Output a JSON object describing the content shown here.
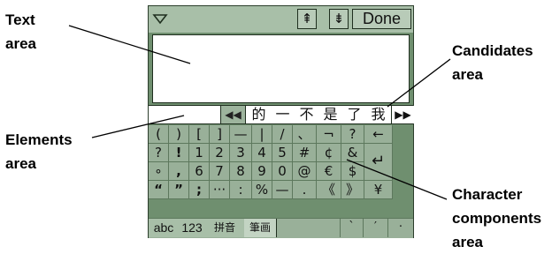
{
  "callouts": {
    "text_area": [
      "Text",
      "area"
    ],
    "candidates_area": [
      "Candidates",
      "area"
    ],
    "elements_area": [
      "Elements",
      "area"
    ],
    "character_components_area": [
      "Character",
      "components",
      "area"
    ]
  },
  "topbar": {
    "menu_icon": "menu-triangle-icon",
    "up_label": "⇞",
    "down_label": "⇟",
    "done_label": "Done"
  },
  "candidates": {
    "prev_label": "◀◀",
    "next_label": "▶▶",
    "items": [
      "的",
      "一",
      "不",
      "是",
      "了",
      "我"
    ]
  },
  "keyboard": {
    "rows": [
      [
        "(",
        ")",
        "[",
        "]",
        "—",
        "|",
        "/",
        "、",
        "¬",
        "?",
        "←"
      ],
      [
        "?",
        "!",
        "1",
        "2",
        "3",
        "4",
        "5",
        "#",
        "¢",
        "&",
        "↵"
      ],
      [
        "∘",
        ",",
        "6",
        "7",
        "8",
        "9",
        "0",
        "@",
        "€",
        "$"
      ],
      [
        "“",
        "”",
        ";",
        "···",
        ":",
        "%",
        "—",
        ".",
        "《",
        "》",
        "¥"
      ]
    ]
  },
  "modes": {
    "items": [
      "abc",
      "123",
      "拼音",
      "筆画"
    ],
    "extra_keys": [
      "`",
      "′",
      "·"
    ]
  }
}
